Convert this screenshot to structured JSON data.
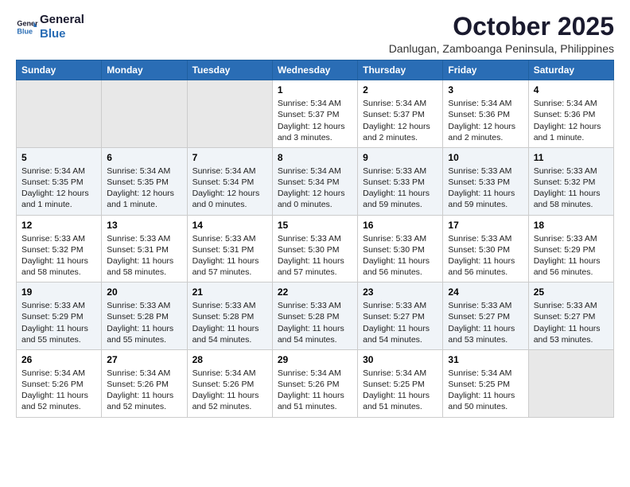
{
  "header": {
    "logo_line1": "General",
    "logo_line2": "Blue",
    "month_year": "October 2025",
    "location": "Danlugan, Zamboanga Peninsula, Philippines"
  },
  "weekdays": [
    "Sunday",
    "Monday",
    "Tuesday",
    "Wednesday",
    "Thursday",
    "Friday",
    "Saturday"
  ],
  "rows": [
    [
      {
        "day": "",
        "empty": true
      },
      {
        "day": "",
        "empty": true
      },
      {
        "day": "",
        "empty": true
      },
      {
        "day": "1",
        "sunrise": "5:34 AM",
        "sunset": "5:37 PM",
        "daylight": "12 hours and 3 minutes."
      },
      {
        "day": "2",
        "sunrise": "5:34 AM",
        "sunset": "5:37 PM",
        "daylight": "12 hours and 2 minutes."
      },
      {
        "day": "3",
        "sunrise": "5:34 AM",
        "sunset": "5:36 PM",
        "daylight": "12 hours and 2 minutes."
      },
      {
        "day": "4",
        "sunrise": "5:34 AM",
        "sunset": "5:36 PM",
        "daylight": "12 hours and 1 minute."
      }
    ],
    [
      {
        "day": "5",
        "sunrise": "5:34 AM",
        "sunset": "5:35 PM",
        "daylight": "12 hours and 1 minute."
      },
      {
        "day": "6",
        "sunrise": "5:34 AM",
        "sunset": "5:35 PM",
        "daylight": "12 hours and 1 minute."
      },
      {
        "day": "7",
        "sunrise": "5:34 AM",
        "sunset": "5:34 PM",
        "daylight": "12 hours and 0 minutes."
      },
      {
        "day": "8",
        "sunrise": "5:34 AM",
        "sunset": "5:34 PM",
        "daylight": "12 hours and 0 minutes."
      },
      {
        "day": "9",
        "sunrise": "5:33 AM",
        "sunset": "5:33 PM",
        "daylight": "11 hours and 59 minutes."
      },
      {
        "day": "10",
        "sunrise": "5:33 AM",
        "sunset": "5:33 PM",
        "daylight": "11 hours and 59 minutes."
      },
      {
        "day": "11",
        "sunrise": "5:33 AM",
        "sunset": "5:32 PM",
        "daylight": "11 hours and 58 minutes."
      }
    ],
    [
      {
        "day": "12",
        "sunrise": "5:33 AM",
        "sunset": "5:32 PM",
        "daylight": "11 hours and 58 minutes."
      },
      {
        "day": "13",
        "sunrise": "5:33 AM",
        "sunset": "5:31 PM",
        "daylight": "11 hours and 58 minutes."
      },
      {
        "day": "14",
        "sunrise": "5:33 AM",
        "sunset": "5:31 PM",
        "daylight": "11 hours and 57 minutes."
      },
      {
        "day": "15",
        "sunrise": "5:33 AM",
        "sunset": "5:30 PM",
        "daylight": "11 hours and 57 minutes."
      },
      {
        "day": "16",
        "sunrise": "5:33 AM",
        "sunset": "5:30 PM",
        "daylight": "11 hours and 56 minutes."
      },
      {
        "day": "17",
        "sunrise": "5:33 AM",
        "sunset": "5:30 PM",
        "daylight": "11 hours and 56 minutes."
      },
      {
        "day": "18",
        "sunrise": "5:33 AM",
        "sunset": "5:29 PM",
        "daylight": "11 hours and 56 minutes."
      }
    ],
    [
      {
        "day": "19",
        "sunrise": "5:33 AM",
        "sunset": "5:29 PM",
        "daylight": "11 hours and 55 minutes."
      },
      {
        "day": "20",
        "sunrise": "5:33 AM",
        "sunset": "5:28 PM",
        "daylight": "11 hours and 55 minutes."
      },
      {
        "day": "21",
        "sunrise": "5:33 AM",
        "sunset": "5:28 PM",
        "daylight": "11 hours and 54 minutes."
      },
      {
        "day": "22",
        "sunrise": "5:33 AM",
        "sunset": "5:28 PM",
        "daylight": "11 hours and 54 minutes."
      },
      {
        "day": "23",
        "sunrise": "5:33 AM",
        "sunset": "5:27 PM",
        "daylight": "11 hours and 54 minutes."
      },
      {
        "day": "24",
        "sunrise": "5:33 AM",
        "sunset": "5:27 PM",
        "daylight": "11 hours and 53 minutes."
      },
      {
        "day": "25",
        "sunrise": "5:33 AM",
        "sunset": "5:27 PM",
        "daylight": "11 hours and 53 minutes."
      }
    ],
    [
      {
        "day": "26",
        "sunrise": "5:34 AM",
        "sunset": "5:26 PM",
        "daylight": "11 hours and 52 minutes."
      },
      {
        "day": "27",
        "sunrise": "5:34 AM",
        "sunset": "5:26 PM",
        "daylight": "11 hours and 52 minutes."
      },
      {
        "day": "28",
        "sunrise": "5:34 AM",
        "sunset": "5:26 PM",
        "daylight": "11 hours and 52 minutes."
      },
      {
        "day": "29",
        "sunrise": "5:34 AM",
        "sunset": "5:26 PM",
        "daylight": "11 hours and 51 minutes."
      },
      {
        "day": "30",
        "sunrise": "5:34 AM",
        "sunset": "5:25 PM",
        "daylight": "11 hours and 51 minutes."
      },
      {
        "day": "31",
        "sunrise": "5:34 AM",
        "sunset": "5:25 PM",
        "daylight": "11 hours and 50 minutes."
      },
      {
        "day": "",
        "empty": true
      }
    ]
  ],
  "labels": {
    "sunrise": "Sunrise:",
    "sunset": "Sunset:",
    "daylight": "Daylight:"
  }
}
